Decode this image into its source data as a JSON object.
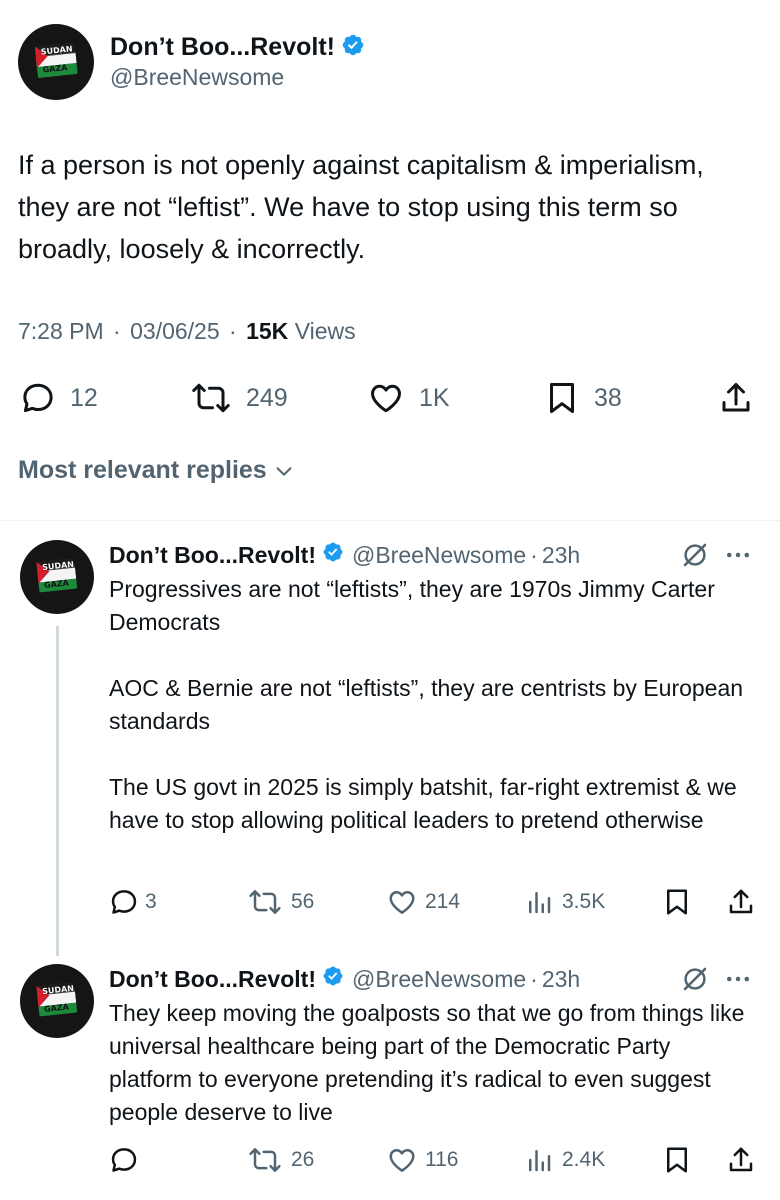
{
  "main_tweet": {
    "display_name": "Don’t Boo...Revolt!",
    "handle": "@BreeNewsome",
    "text": "If a person is not openly against capitalism & imperialism, they are not “leftist”. We have to stop using this term so broadly, loosely & incorrectly.",
    "time": "7:28 PM",
    "date": "03/06/25",
    "views_count": "15K",
    "views_label": "Views",
    "separator": "·",
    "actions": {
      "replies": "12",
      "reposts": "249",
      "likes": "1K",
      "bookmarks": "38"
    }
  },
  "replies_sort": {
    "label": "Most relevant replies"
  },
  "avatar_flag": {
    "top_text": "SUDAN",
    "bottom_text": "GAZA"
  },
  "replies": [
    {
      "display_name": "Don’t Boo...Revolt!",
      "handle": "@BreeNewsome",
      "separator": "·",
      "time": "23h",
      "paragraphs": [
        "Progressives are not “leftists”, they are 1970s Jimmy Carter Democrats",
        "AOC & Bernie are not “leftists”, they are centrists by European standards",
        "The US govt in 2025 is simply batshit, far-right extremist & we have to stop allowing political leaders to pretend otherwise"
      ],
      "actions": {
        "replies": "3",
        "reposts": "56",
        "likes": "214",
        "views": "3.5K"
      }
    },
    {
      "display_name": "Don’t Boo...Revolt!",
      "handle": "@BreeNewsome",
      "separator": "·",
      "time": "23h",
      "paragraphs": [
        "They keep moving the goalposts so that we go from things like universal healthcare being part of the Democratic Party platform to everyone pretending it’s radical to even suggest people deserve to live"
      ],
      "actions": {
        "replies": "",
        "reposts": "26",
        "likes": "116",
        "views": "2.4K"
      }
    }
  ],
  "colors": {
    "text_primary": "#0f1419",
    "text_secondary": "#536471",
    "verified_blue": "#1d9bf0",
    "divider": "#eff3f4",
    "thread_line": "#cfd9de"
  }
}
